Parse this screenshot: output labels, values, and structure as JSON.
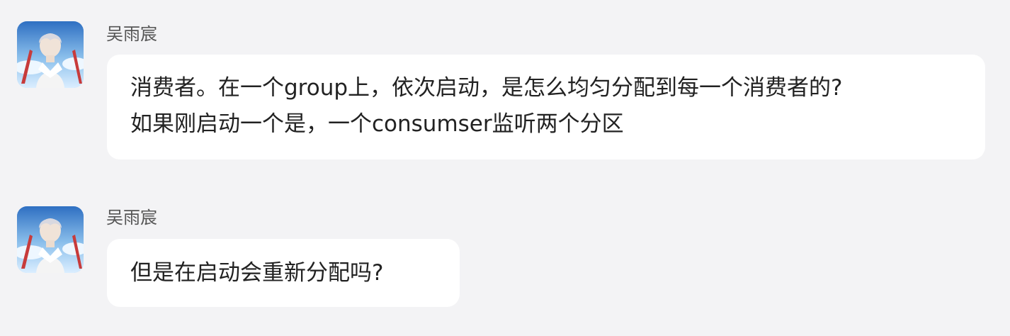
{
  "messages": [
    {
      "sender": "吴雨宸",
      "lines": [
        "消费者。在一个group上，依次启动，是怎么均匀分配到每一个消费者的?",
        "如果刚启动一个是，一个consumser监听两个分区"
      ]
    },
    {
      "sender": "吴雨宸",
      "lines": [
        "但是在启动会重新分配吗?"
      ]
    }
  ]
}
